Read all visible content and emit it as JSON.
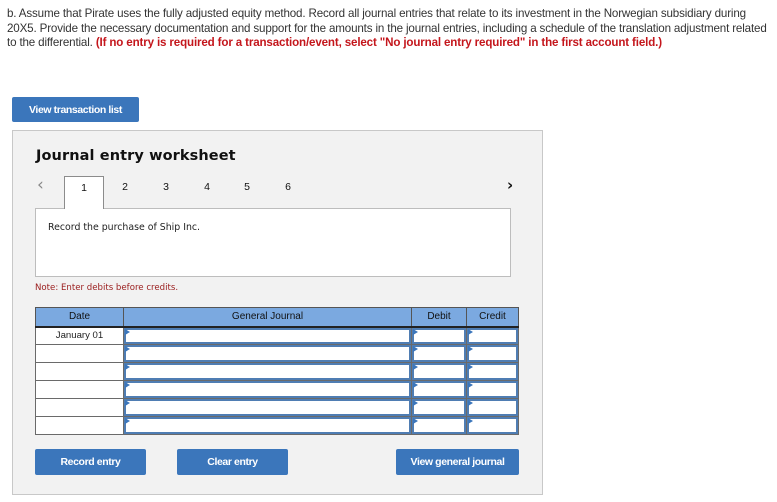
{
  "instructions": {
    "text": "b. Assume that Pirate uses the fully adjusted equity method. Record all journal entries that relate to its investment in the Norwegian subsidiary during 20X5. Provide the necessary documentation and support for the amounts in the journal entries, including a schedule of the translation adjustment related to the differential.",
    "emphasis": "(If no entry is required for a transaction/event, select \"No journal entry required\" in the first account field.)"
  },
  "view_transaction_list_label": "View transaction list",
  "worksheet": {
    "title": "Journal entry worksheet",
    "prev_icon": "chevron-left-icon",
    "next_icon": "chevron-right-icon",
    "tabs": [
      {
        "label": "1",
        "active": true
      },
      {
        "label": "2",
        "active": false
      },
      {
        "label": "3",
        "active": false
      },
      {
        "label": "4",
        "active": false
      },
      {
        "label": "5",
        "active": false
      },
      {
        "label": "6",
        "active": false
      }
    ],
    "description": "Record the purchase of Ship Inc.",
    "note": "Note: Enter debits before credits.",
    "table": {
      "headers": {
        "date": "Date",
        "account": "General Journal",
        "debit": "Debit",
        "credit": "Credit"
      },
      "rows": [
        {
          "date": "January 01",
          "account": "",
          "debit": "",
          "credit": ""
        },
        {
          "date": "",
          "account": "",
          "debit": "",
          "credit": ""
        },
        {
          "date": "",
          "account": "",
          "debit": "",
          "credit": ""
        },
        {
          "date": "",
          "account": "",
          "debit": "",
          "credit": ""
        },
        {
          "date": "",
          "account": "",
          "debit": "",
          "credit": ""
        },
        {
          "date": "",
          "account": "",
          "debit": "",
          "credit": ""
        }
      ]
    },
    "buttons": {
      "record": "Record entry",
      "clear": "Clear entry",
      "view_general_journal": "View general journal"
    }
  },
  "colors": {
    "button_blue": "#3b76bb",
    "header_blue": "#7ba9e0",
    "emphasis_red": "#c4161c",
    "note_red": "#9a1c1c",
    "panel_bg": "#f2f2f2"
  }
}
